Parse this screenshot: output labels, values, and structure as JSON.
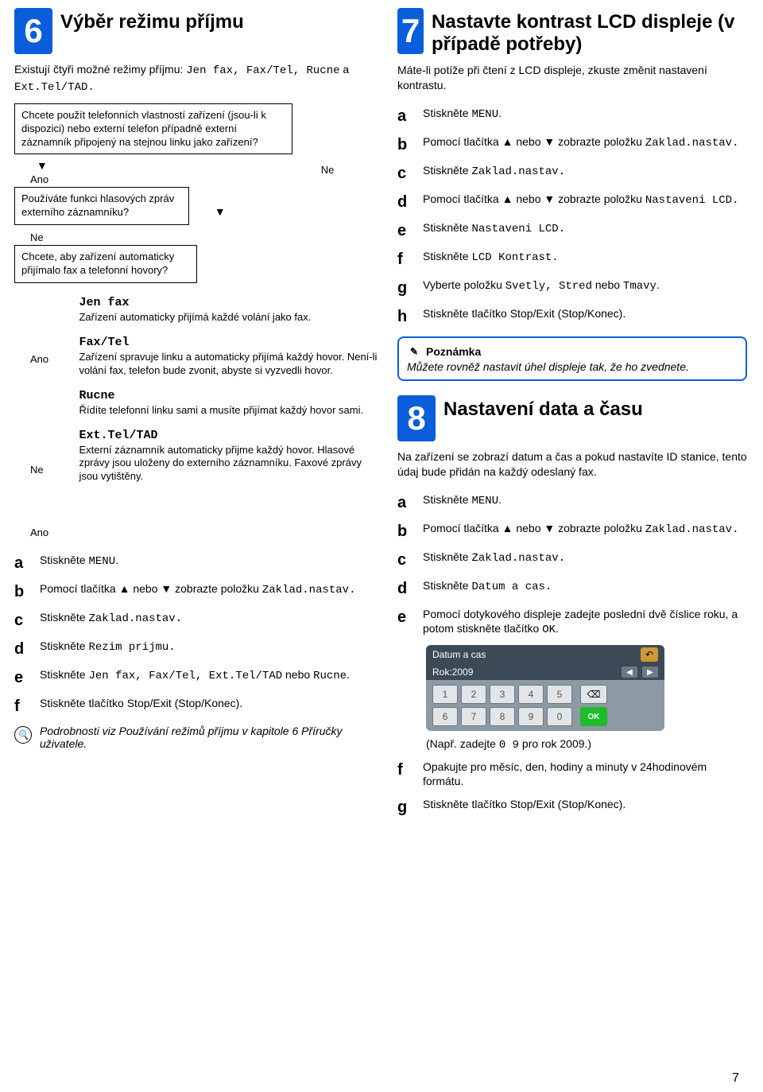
{
  "page_number": "7",
  "left": {
    "step_num": "6",
    "title": "Výběr režimu příjmu",
    "intro_a": "Existují čtyři možné režimy příjmu: ",
    "intro_modes": "Jen fax, Fax/Tel, Rucne",
    "intro_mid": " a ",
    "intro_last": "Ext.Tel/TAD.",
    "q1": "Chcete použít telefonních vlastností zařízení (jsou-li k dispozici) nebo externí telefon případně externí záznamník připojený na stejnou linku jako zařízení?",
    "ano": "Ano",
    "ne": "Ne",
    "q2": "Používáte funkci hlasových zpráv externího záznamníku?",
    "q3": "Chcete, aby zařízení automaticky přijímalo fax a telefonní hovory?",
    "modes": [
      {
        "name": "Jen fax",
        "desc": "Zařízení automaticky přijímá každé volání jako fax."
      },
      {
        "name": "Fax/Tel",
        "desc": "Zařízení spravuje linku a automaticky přijímá každý hovor. Není-li volání fax, telefon bude zvonit, abyste si vyzvedli hovor."
      },
      {
        "name": "Rucne",
        "desc": "Řídíte telefonní linku sami a musíte přijímat každý hovor sami."
      },
      {
        "name": "Ext.Tel/TAD",
        "desc": "Externí záznamník automaticky přijme každý hovor. Hlasové zprávy jsou uloženy do externího záznamníku. Faxové zprávy jsou vytištěny."
      }
    ],
    "steps": {
      "a": {
        "pre": "Stiskněte ",
        "code": "MENU",
        "post": "."
      },
      "b": {
        "pre": "Pomocí tlačítka ▲ nebo ▼ zobrazte položku ",
        "code": "Zaklad.nastav.",
        "post": ""
      },
      "c": {
        "pre": "Stiskněte ",
        "code": "Zaklad.nastav.",
        "post": ""
      },
      "d": {
        "pre": "Stiskněte ",
        "code": "Rezim prijmu.",
        "post": ""
      },
      "e": {
        "pre": "Stiskněte ",
        "code": "Jen fax, Fax/Tel, Ext.Tel/TAD",
        "mid": " nebo ",
        "code2": "Rucne",
        "post": "."
      },
      "f": "Stiskněte tlačítko Stop/Exit (Stop/Konec).",
      "ref": "Podrobnosti viz Používání režimů příjmu v kapitole 6 Příručky uživatele."
    }
  },
  "right": {
    "sec7": {
      "num": "7",
      "title": "Nastavte kontrast LCD displeje (v případě potřeby)",
      "intro": "Máte-li potíže při čtení z LCD displeje, zkuste změnit nastavení kontrastu.",
      "a": {
        "pre": "Stiskněte ",
        "code": "MENU",
        "post": "."
      },
      "b": {
        "pre": "Pomocí tlačítka ▲ nebo ▼ zobrazte položku ",
        "code": "Zaklad.nastav.",
        "post": ""
      },
      "c": {
        "pre": "Stiskněte ",
        "code": "Zaklad.nastav.",
        "post": ""
      },
      "d": {
        "pre": "Pomocí tlačítka ▲ nebo ▼ zobrazte položku ",
        "code": "Nastaveni LCD.",
        "post": ""
      },
      "e": {
        "pre": "Stiskněte ",
        "code": "Nastaveni LCD.",
        "post": ""
      },
      "f": {
        "pre": "Stiskněte ",
        "code": "LCD Kontrast.",
        "post": ""
      },
      "g": {
        "pre": "Vyberte položku ",
        "code": "Svetly, Stred",
        "mid": " nebo ",
        "code2": "Tmavy",
        "post": "."
      },
      "h": "Stiskněte tlačítko Stop/Exit (Stop/Konec).",
      "note_head": "Poznámka",
      "note_body": "Můžete rovněž nastavit úhel displeje tak, že ho zvednete."
    },
    "sec8": {
      "num": "8",
      "title": "Nastavení data a času",
      "intro": "Na zařízení se zobrazí datum a čas a pokud nastavíte ID stanice, tento údaj bude přidán na každý odeslaný fax.",
      "a": {
        "pre": "Stiskněte ",
        "code": "MENU",
        "post": "."
      },
      "b": {
        "pre": "Pomocí tlačítka ▲ nebo ▼ zobrazte položku ",
        "code": "Zaklad.nastav.",
        "post": ""
      },
      "c": {
        "pre": "Stiskněte ",
        "code": "Zaklad.nastav.",
        "post": ""
      },
      "d": {
        "pre": "Stiskněte ",
        "code": "Datum a cas.",
        "post": ""
      },
      "e": {
        "pre": "Pomocí dotykového displeje zadejte poslední dvě číslice roku, a potom stiskněte tlačítko ",
        "code": "OK",
        "post": "."
      },
      "keypad": {
        "title": "Datum a cas",
        "year": "Rok:2009",
        "keys_r1": [
          "1",
          "2",
          "3",
          "4",
          "5"
        ],
        "keys_r2": [
          "6",
          "7",
          "8",
          "9",
          "0"
        ],
        "ok": "OK"
      },
      "example_pre": "(Např. zadejte ",
      "example_code": "0 9",
      "example_post": " pro rok 2009.)",
      "f": "Opakujte pro měsíc, den, hodiny a minuty v 24hodinovém formátu.",
      "g": "Stiskněte tlačítko Stop/Exit (Stop/Konec)."
    }
  }
}
